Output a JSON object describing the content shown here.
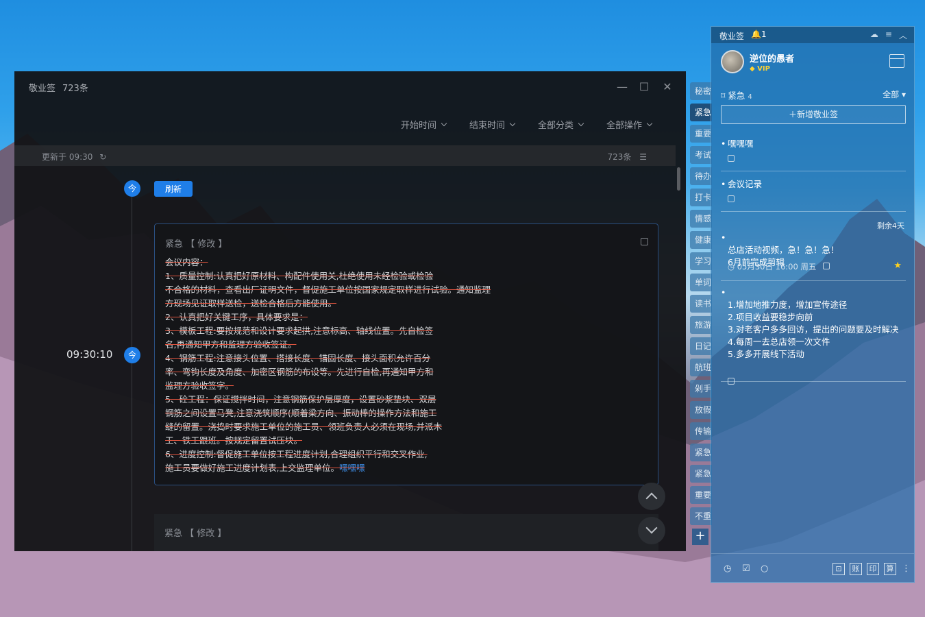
{
  "main": {
    "app_name": "敬业签",
    "count_label": "723条",
    "filters": [
      "开始时间",
      "结束时间",
      "全部分类",
      "全部操作"
    ],
    "updated_text": "更新于 09:30",
    "total_count": "723条",
    "today_dot": "今",
    "refresh_label": "刷新",
    "entry_time": "09:30:10",
    "card": {
      "header": "紧急 【 修改 】",
      "lines": [
        "会议内容：",
        "1、质量控制:认真把好原材料、构配件使用关,杜绝使用未经检验或检验",
        "不合格的材料，查看出厂证明文件，督促施工单位按国家规定取样进行试验。通知监理",
        "方现场见证取样送检，送检合格后方能使用。",
        "2、认真把好关键工序，具体要求是：",
        "3、模板工程:要按规范和设计要求起拱,注意标高、轴线位置。先自检签",
        "名,再通知甲方和监理方验收签证。",
        "4、钢筋工程:注意接头位置、搭接长度、锚固长度、接头面积允许百分",
        "率、弯钩长度及角度、加密区钢筋的布设等。先进行自检,再通知甲方和",
        "监理方验收签字。",
        "5、砼工程：保证搅拌时间，注意钢筋保护层厚度，设置砂浆垫块、双层",
        "钢筋之间设置马凳,注意浇筑顺序(顺着梁方向、振动棒的操作方法和施工",
        "缝的留置。浇捣时要求施工单位的施工员、领班负责人必须在现场,并派木",
        "工、铁工跟班。按规定留置试压块。",
        "6、进度控制:督促施工单位按工程进度计划,合理组织平行和交叉作业,",
        "施工员要做好施工进度计划表,上交监理单位。"
      ],
      "tag": "嘿嘿嘿"
    },
    "card2_header": "紧急 【 修改 】"
  },
  "side_tabs": [
    "秘密",
    "紧急",
    "重要",
    "考试",
    "待办",
    "打卡",
    "情感",
    "健康",
    "学习",
    "单词",
    "读书",
    "旅游",
    "日记",
    "航班",
    "剁手",
    "放假",
    "传输",
    "紧急",
    "紧急",
    "重要",
    "不重"
  ],
  "side_tab_add": "+",
  "panel": {
    "app_name": "敬业签",
    "notify_count": "1",
    "username": "逆位的愚者",
    "vip_label": "VIP",
    "category": "紧急",
    "category_count": "4",
    "filter_all": "全部",
    "add_label": "新增敬业签",
    "notes": [
      {
        "text": "嘿嘿嘿"
      },
      {
        "text": "会议记录"
      },
      {
        "remaining": "剩余4天",
        "text": "总店活动视频，急！急！急！\n6月前完成剪辑",
        "due": "05月30日 16:00 周五"
      },
      {
        "text": "1.增加地推力度，增加宣传途径\n2.项目收益要稳步向前\n3.对老客户多多回访，提出的问题要及时解决\n4.每周一去总店领一次文件\n5.多多开展线下活动"
      }
    ],
    "footer_boxes": [
      "账",
      "印",
      "算"
    ]
  },
  "colors": {
    "accent": "#1f7ee8",
    "strike": "#e0553f",
    "star": "#ffd21e"
  }
}
